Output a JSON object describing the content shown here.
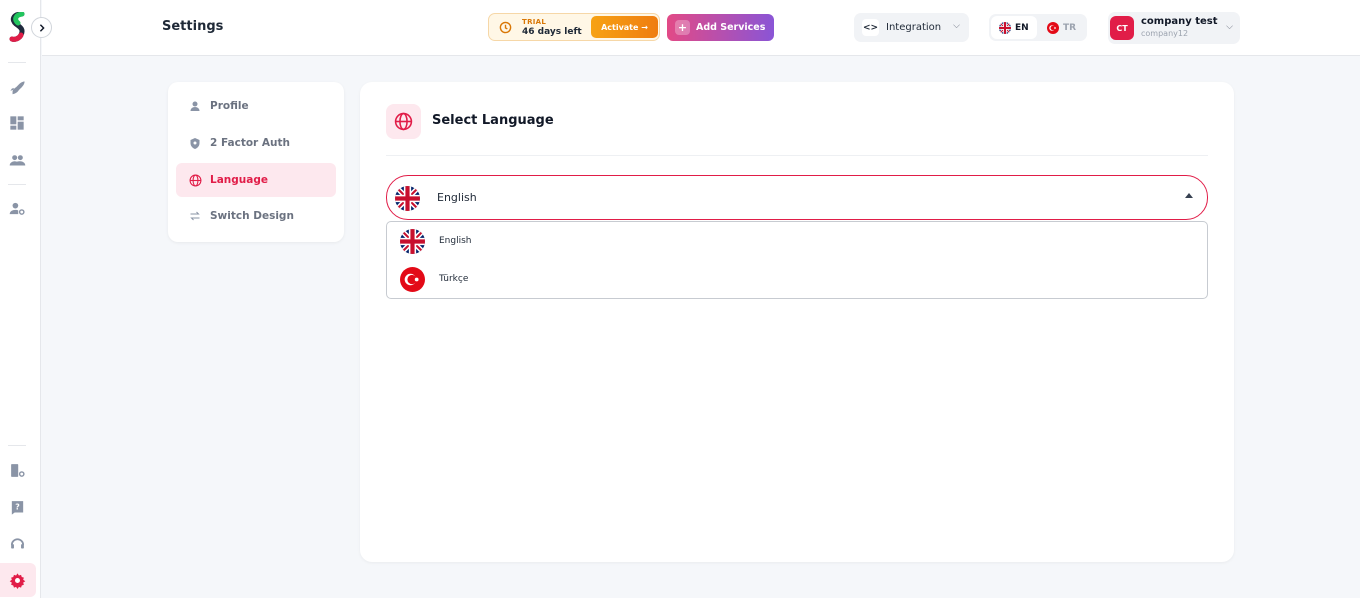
{
  "header": {
    "page_title": "Settings",
    "trial": {
      "badge": "TRIAL",
      "days_left": "46 days left",
      "activate_label": "Activate →"
    },
    "add_services_label": "Add Services",
    "integration_label": "Integration",
    "languages": [
      {
        "code": "EN",
        "selected": true
      },
      {
        "code": "TR",
        "selected": false
      }
    ],
    "user": {
      "initials": "CT",
      "name": "company test",
      "username": "company12"
    }
  },
  "sidebar_rail": {
    "icons": [
      "rocket-icon",
      "dashboard-icon",
      "users-icon",
      "user-settings-icon",
      "user-settings-2-icon",
      "help-book-icon",
      "support-icon",
      "gear-icon"
    ],
    "active": "gear-icon",
    "accent": "#e11d48"
  },
  "settings_nav": {
    "items": [
      {
        "label": "Profile",
        "icon": "user-icon",
        "active": false
      },
      {
        "label": "2 Factor Auth",
        "icon": "shield-icon",
        "active": false
      },
      {
        "label": "Language",
        "icon": "globe-icon",
        "active": true
      },
      {
        "label": "Switch Design",
        "icon": "swap-icon",
        "active": false
      }
    ]
  },
  "language_card": {
    "title": "Select Language",
    "selected_value": "English",
    "options": [
      {
        "label": "English",
        "flag": "uk-flag-icon"
      },
      {
        "label": "Türkçe",
        "flag": "turkey-flag-icon"
      }
    ]
  },
  "colors": {
    "accent": "#e11d48",
    "accent_soft": "#fde8ee",
    "trial_orange": "#f59e0b",
    "services_gradient": [
      "#e24a86",
      "#8a55d6"
    ]
  }
}
